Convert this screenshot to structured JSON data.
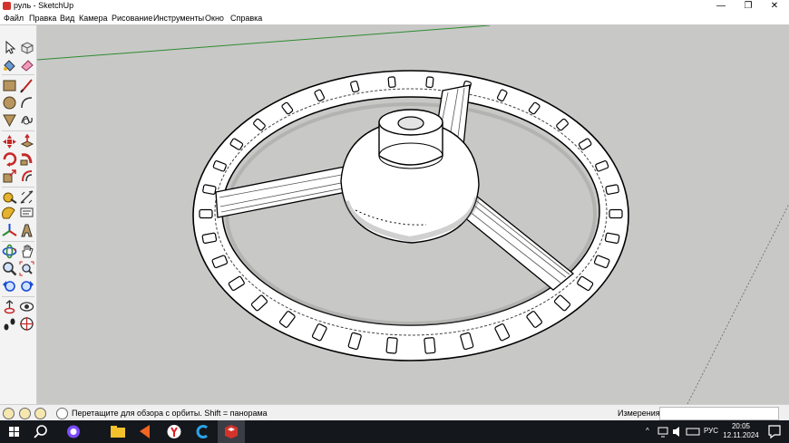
{
  "window": {
    "title": "руль - SketchUp",
    "app_icon": "sketchup-icon",
    "controls": {
      "minimize": "—",
      "restore": "❐",
      "close": "✕"
    }
  },
  "menu": [
    "Файл",
    "Правка",
    "Вид",
    "Камера",
    "Рисование",
    "Инструменты",
    "Окно",
    "Справка"
  ],
  "toolbar": {
    "tools": [
      "select-icon",
      "make-component-icon",
      "paint-bucket-icon",
      "eraser-icon",
      "rectangle-icon",
      "line-icon",
      "circle-icon",
      "arc-icon",
      "polygon-icon",
      "freehand-icon",
      "move-icon",
      "push-pull-icon",
      "rotate-icon",
      "follow-me-icon",
      "scale-icon",
      "offset-icon",
      "tape-measure-icon",
      "dimension-icon",
      "protractor-icon",
      "text-icon",
      "axes-icon",
      "3d-text-icon",
      "orbit-icon",
      "pan-icon",
      "zoom-icon",
      "zoom-extents-icon",
      "previous-view-icon",
      "next-view-icon",
      "position-camera-icon",
      "look-around-icon",
      "walk-icon",
      "section-plane-icon"
    ]
  },
  "status": {
    "hint": "Перетащите для обзора с орбиты.  Shift = панорама",
    "measurements_label": "Измерения",
    "measurements_value": ""
  },
  "taskbar": {
    "items": [
      "windows-start-icon",
      "search-icon",
      "cortana-icon",
      "file-explorer-icon",
      "media-player-icon",
      "yandex-browser-icon",
      "ccleaner-icon",
      "sketchup-taskbar-icon"
    ],
    "tray": {
      "chevron": "^",
      "lang": "РУС"
    },
    "clock": {
      "time": "20:05",
      "date": "12.11.2024"
    }
  },
  "colors": {
    "viewport_bg": "#c8c8c7",
    "taskbar_bg": "#14171c",
    "axis_green": "#2f8b2f",
    "model_face": "#ffffff",
    "edges": "#000000"
  }
}
